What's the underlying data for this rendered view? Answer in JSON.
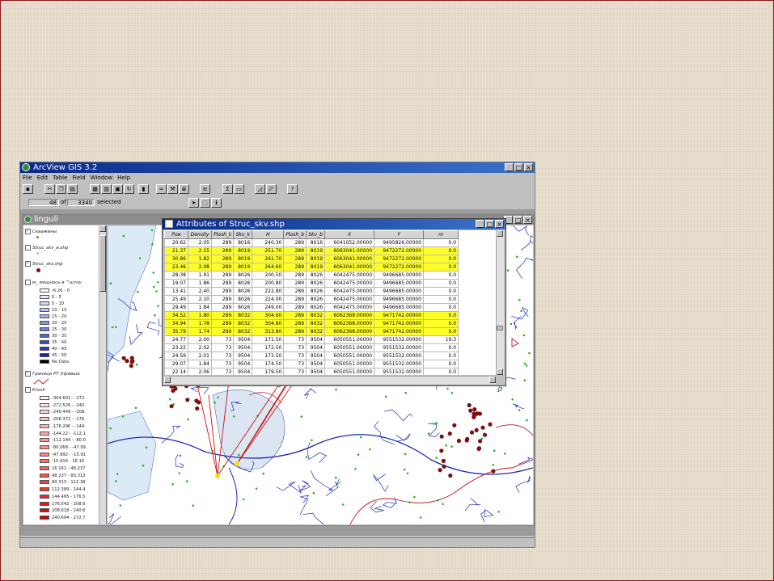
{
  "app": {
    "title": "ArcView GIS 3.2",
    "menu": [
      "File",
      "Edit",
      "Table",
      "Field",
      "Window",
      "Help"
    ],
    "status": {
      "selected_count": "48",
      "of_label": "of",
      "total_count": "3340",
      "selected_label": "selected"
    }
  },
  "view": {
    "title": "linguli",
    "layers": [
      {
        "name": "Скважины",
        "checked": true
      },
      {
        "name": "Struc_skv_и.shp",
        "checked": false
      },
      {
        "name": "Struc_skv.shp",
        "checked": true
      },
      {
        "name": "м_ мощнось в ^штну",
        "checked": false
      }
    ],
    "thickness_legend": [
      "-6.26 - 0",
      "0 - 5",
      "5 - 10",
      "10 - 15",
      "15 - 20",
      "20 - 25",
      "25 - 30",
      "30 - 35",
      "35 - 40",
      "40 - 45",
      "45 - 50",
      "No Data"
    ],
    "boundary_layer": {
      "name": "Граница РТ (правша",
      "checked": true
    },
    "krovli_layer": {
      "name": "Krovli",
      "checked": false
    },
    "krovli_legend": [
      "-304.601 - -272.",
      "-272.526 - -240.",
      "-240.449 - -208.",
      "-208.372 - -176.",
      "-176.296 - -144.",
      "-144.22 - -112.1",
      "-112.144 - -80.0",
      "-80.068 - -47.99",
      "-47.992 - -15.91",
      "-15.916 - 16.16",
      "16.161 - 48.237",
      "48.237 - 80.313",
      "80.313 - 112.38",
      "112.389 - 144.4",
      "144.465 - 176.5",
      "176.542 - 208.6",
      "208.618 - 240.6",
      "240.694 - 272.7"
    ]
  },
  "attributes": {
    "title": "Attributes of Struc_skv.shp",
    "columns": [
      "Poи",
      "Density",
      "Plosh_k",
      "Skv_k",
      "H",
      "Plosh_b",
      "Skv_b",
      "X",
      "Y",
      "m"
    ],
    "rows": [
      {
        "cells": [
          "20.62",
          "2.05",
          "289",
          "8016",
          "240.30",
          "289",
          "8016",
          "6041052.00000",
          "9495826.00000",
          "0.0"
        ],
        "selected": false
      },
      {
        "cells": [
          "21.37",
          "2.15",
          "289",
          "8019",
          "251.70",
          "289",
          "8019",
          "6063041.00000",
          "9472272.00000",
          "0.0"
        ],
        "selected": true
      },
      {
        "cells": [
          "30.86",
          "1.82",
          "289",
          "8019",
          "261.70",
          "289",
          "8019",
          "6063041.00000",
          "9472272.00000",
          "0.0"
        ],
        "selected": true
      },
      {
        "cells": [
          "23.46",
          "2.08",
          "289",
          "8019",
          "264.60",
          "289",
          "8019",
          "6063041.00000",
          "9472272.00000",
          "0.0"
        ],
        "selected": true
      },
      {
        "cells": [
          "28.38",
          "1.91",
          "289",
          "8026",
          "200.50",
          "289",
          "8026",
          "6042475.00000",
          "9496685.00000",
          "0.0"
        ],
        "selected": false
      },
      {
        "cells": [
          "19.07",
          "1.86",
          "289",
          "8026",
          "200.80",
          "289",
          "8026",
          "6042475.00000",
          "9496685.00000",
          "0.0"
        ],
        "selected": false
      },
      {
        "cells": [
          "13.41",
          "2.40",
          "289",
          "8026",
          "222.80",
          "289",
          "8026",
          "6042475.00000",
          "9496685.00000",
          "0.0"
        ],
        "selected": false
      },
      {
        "cells": [
          "25.49",
          "2.10",
          "289",
          "8026",
          "224.00",
          "289",
          "8026",
          "6042475.00000",
          "9496685.00000",
          "0.0"
        ],
        "selected": false
      },
      {
        "cells": [
          "29.49",
          "1.84",
          "289",
          "8026",
          "249.00",
          "289",
          "8026",
          "6042475.00000",
          "9496685.00000",
          "0.0"
        ],
        "selected": false
      },
      {
        "cells": [
          "34.52",
          "1.80",
          "289",
          "8032",
          "304.60",
          "289",
          "8032",
          "6062368.00000",
          "9471742.00000",
          "0.0"
        ],
        "selected": true
      },
      {
        "cells": [
          "34.94",
          "1.78",
          "289",
          "8032",
          "304.80",
          "289",
          "8032",
          "6062368.00000",
          "9471742.00000",
          "0.0"
        ],
        "selected": true
      },
      {
        "cells": [
          "35.79",
          "1.74",
          "289",
          "8032",
          "313.80",
          "289",
          "8032",
          "6062368.00000",
          "9471742.00000",
          "0.0"
        ],
        "selected": true
      },
      {
        "cells": [
          "24.77",
          "2.00",
          "73",
          "9504",
          "171.50",
          "73",
          "9504",
          "6050551.00000",
          "9551532.00000",
          "19.3"
        ],
        "selected": false
      },
      {
        "cells": [
          "23.22",
          "2.02",
          "73",
          "9504",
          "172.50",
          "73",
          "9504",
          "6050551.00000",
          "9551532.00000",
          "0.0"
        ],
        "selected": false
      },
      {
        "cells": [
          "24.59",
          "2.01",
          "73",
          "9504",
          "173.50",
          "73",
          "9504",
          "6050551.00000",
          "9551532.00000",
          "0.0"
        ],
        "selected": false
      },
      {
        "cells": [
          "29.07",
          "1.84",
          "73",
          "9504",
          "174.50",
          "73",
          "9504",
          "6050551.00000",
          "9551532.00000",
          "0.0"
        ],
        "selected": false
      },
      {
        "cells": [
          "22.14",
          "2.06",
          "73",
          "9504",
          "179.50",
          "73",
          "9504",
          "6050551.00000",
          "9551532.00000",
          "0.0"
        ],
        "selected": false
      }
    ]
  },
  "icons": [
    "globe-icon",
    "save-icon",
    "cut-icon",
    "copy-icon",
    "paste-icon",
    "table-icon",
    "refresh-icon",
    "chart-icon",
    "binoculars-icon",
    "hammer-icon",
    "sort-icon",
    "sigma-icon",
    "pointer-icon",
    "help-icon"
  ],
  "colors": {
    "selection": "#ffff28",
    "title_active": "#0a2a8c",
    "river": "#1a2ab8",
    "well": "#22b822",
    "boundary": "#c01818",
    "structure": "#7a1010"
  }
}
